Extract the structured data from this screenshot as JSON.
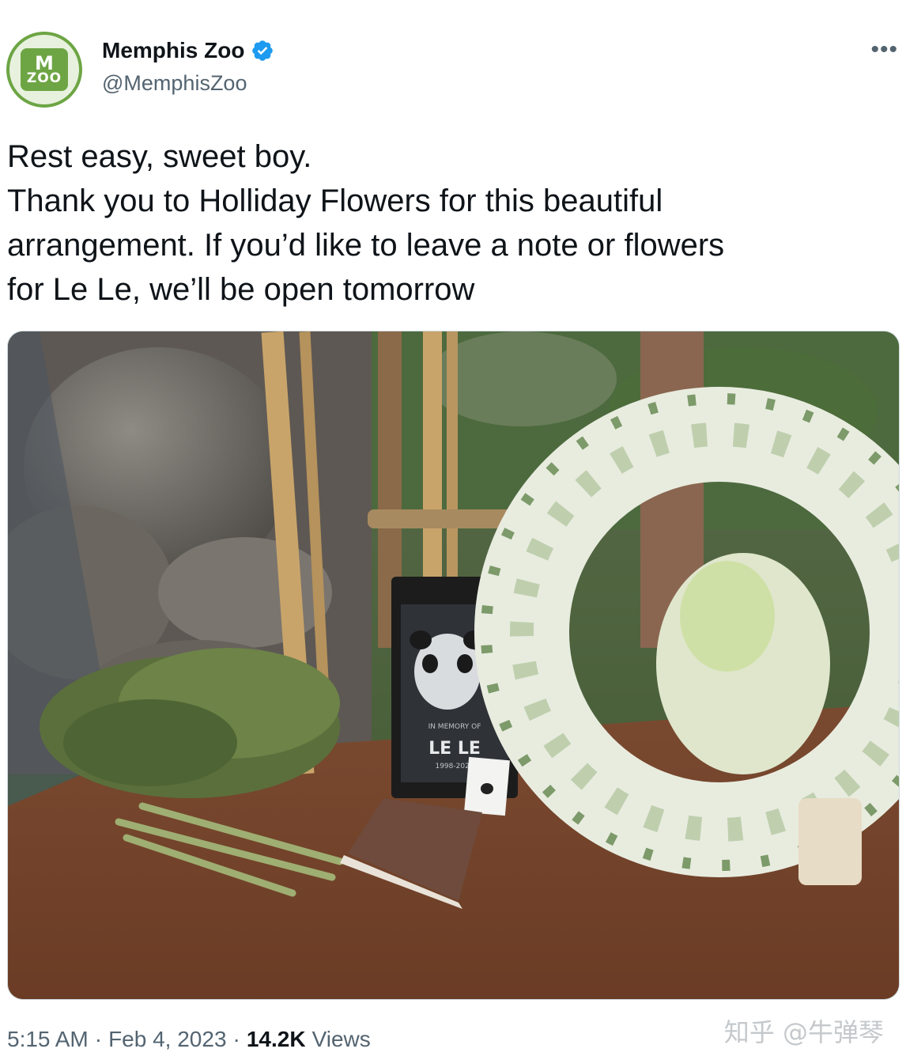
{
  "tweet": {
    "author": {
      "display_name": "Memphis Zoo",
      "handle": "@MemphisZoo",
      "verified": true,
      "avatar_text_top": "M",
      "avatar_text_bottom": "ZOO"
    },
    "more_label": "•••",
    "text_lines": [
      "Rest easy, sweet boy.",
      "Thank you to Holliday Flowers for this beautiful",
      "arrangement. If you’d like to leave a note or flowers",
      "for Le Le, we’ll be open tomorrow"
    ],
    "media": {
      "sign_name": "LE LE",
      "sign_small_text": "IN MEMORY OF",
      "sign_years": "1998-2023"
    },
    "time": "5:15 AM",
    "date": "Feb 4, 2023",
    "separator": "·",
    "views_count": "14.2K",
    "views_label": "Views"
  },
  "watermark": "知乎 @牛弹琴",
  "colors": {
    "brand_green": "#6da544",
    "verified_blue": "#1d9bf0",
    "text_primary": "#0f1419",
    "text_secondary": "#536471"
  },
  "icons": {
    "verified": "verified-badge-icon",
    "more": "more-options-icon"
  }
}
